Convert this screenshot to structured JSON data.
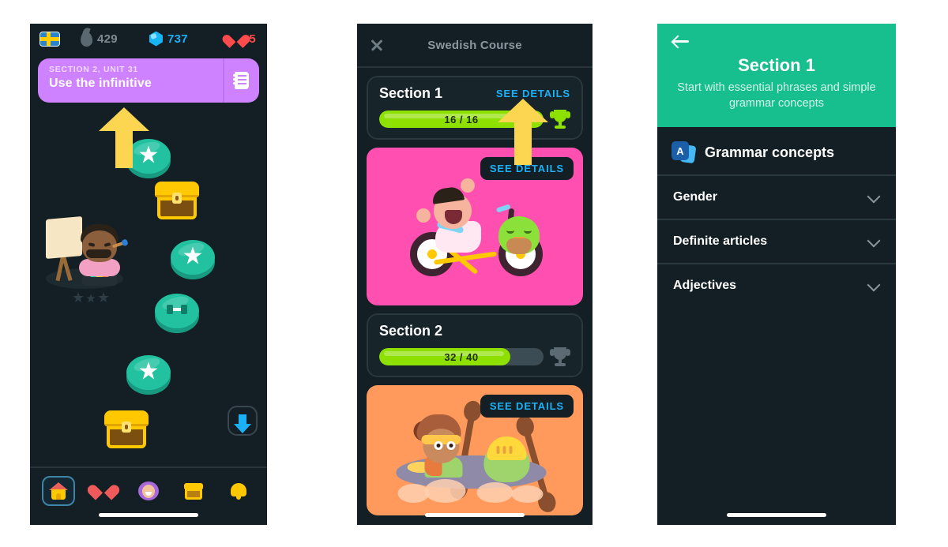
{
  "panel1": {
    "name": "learning-path-screen",
    "stats": {
      "flag_label": "Swedish flag",
      "streak_icon": "flame-icon",
      "streak_value": "429",
      "gem_icon": "gem-icon",
      "gem_value": "737",
      "heart_icon": "heart-icon",
      "heart_value": "5"
    },
    "unit_banner": {
      "kicker": "SECTION 2, UNIT 31",
      "title": "Use the infinitive",
      "guide_icon": "guidebook-icon",
      "color": "#CE82FF"
    },
    "path_nodes": [
      {
        "type": "star-lesson-node",
        "state": "available"
      },
      {
        "type": "chest-node",
        "state": "locked"
      },
      {
        "type": "star-lesson-node",
        "state": "available"
      },
      {
        "type": "dumbbell-practice-node",
        "state": "available"
      },
      {
        "type": "star-lesson-node",
        "state": "available"
      },
      {
        "type": "chest-node",
        "state": "locked"
      }
    ],
    "character": "painter-character-illustration",
    "progress_stars": "three-grey-stars",
    "scroll_button": "scroll-to-bottom-icon",
    "tabs": [
      {
        "name": "tab-learn",
        "icon": "home-icon",
        "active": true
      },
      {
        "name": "tab-leaderboard",
        "icon": "heart-icon",
        "active": false
      },
      {
        "name": "tab-profile",
        "icon": "avatar-icon",
        "active": false
      },
      {
        "name": "tab-quests",
        "icon": "treasure-chest-icon",
        "active": false
      },
      {
        "name": "tab-notifications",
        "icon": "bell-icon",
        "active": false
      }
    ]
  },
  "panel2": {
    "name": "course-sections-screen",
    "header": {
      "close_icon": "close-icon",
      "title": "Swedish Course"
    },
    "sections": [
      {
        "title": "Section 1",
        "see_details": "SEE DETAILS",
        "progress_text": "16 / 16",
        "progress_percent": 100,
        "trophy_state": "complete",
        "art_color": "#FF4FB0",
        "art_label": "bicycle-celebration-illustration"
      },
      {
        "title": "Section 2",
        "see_details": "SEE DETAILS",
        "progress_text": "32 / 40",
        "progress_percent": 80,
        "trophy_state": "incomplete",
        "art_color": "#FF9A5C",
        "art_label": "kayaking-illustration"
      }
    ]
  },
  "panel3": {
    "name": "section-details-screen",
    "header": {
      "back_icon": "back-arrow-icon",
      "title": "Section 1",
      "subtitle": "Start with essential phrases and simple grammar concepts",
      "color": "#17BE8E"
    },
    "grammar": {
      "icon": "flashcard-icon",
      "icon_letter": "A",
      "title": "Grammar concepts",
      "rows": [
        {
          "label": "Gender",
          "chevron": "chevron-down-icon"
        },
        {
          "label": "Definite articles",
          "chevron": "chevron-down-icon"
        },
        {
          "label": "Adjectives",
          "chevron": "chevron-down-icon"
        }
      ]
    }
  },
  "annotations": {
    "color": "#FCD650",
    "arrows": [
      {
        "name": "arrow-pointing-to-unit-banner"
      },
      {
        "name": "arrow-pointing-to-see-details"
      }
    ]
  }
}
